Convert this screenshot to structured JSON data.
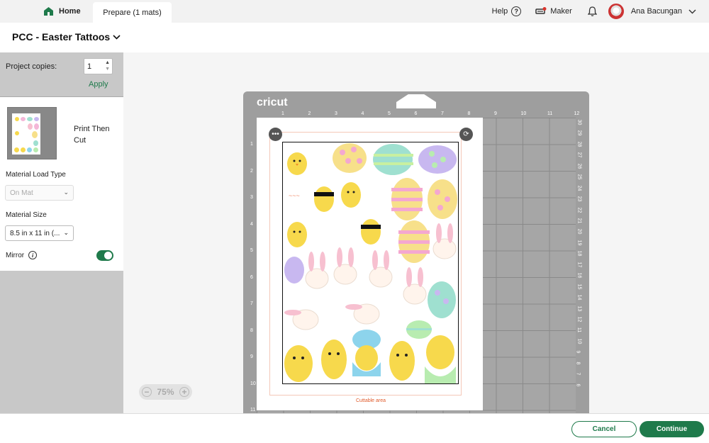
{
  "topbar": {
    "home_label": "Home",
    "prepare_tab_label": "Prepare (1 mats)",
    "help_label": "Help",
    "machine_label": "Maker",
    "user_name": "Ana Bacungan"
  },
  "project": {
    "title": "PCC - Easter Tattoos"
  },
  "left_panel": {
    "copies_label": "Project copies:",
    "copies_value": "1",
    "apply_label": "Apply",
    "mat_mode_label": "Print Then Cut",
    "material_load_label": "Material Load Type",
    "material_load_value": "On Mat",
    "material_size_label": "Material Size",
    "material_size_value": "8.5 in x 11 in (...",
    "mirror_label": "Mirror",
    "mirror_on": true
  },
  "mat": {
    "brand": "cricut",
    "cut_area_label": "Cuttable area",
    "top_ruler": [
      "1",
      "2",
      "3",
      "4",
      "5",
      "6",
      "7",
      "8",
      "9",
      "10",
      "11",
      "12"
    ],
    "left_ruler": [
      "1",
      "2",
      "3",
      "4",
      "5",
      "6",
      "7",
      "8",
      "9",
      "10",
      "11"
    ],
    "right_ruler": [
      "30",
      "29",
      "28",
      "27",
      "26",
      "25",
      "24",
      "23",
      "22",
      "21",
      "20",
      "19",
      "18",
      "17",
      "16",
      "15",
      "14",
      "13",
      "12",
      "11",
      "10",
      "9",
      "8",
      "7",
      "6"
    ]
  },
  "zoom": {
    "level": "75%"
  },
  "footer": {
    "cancel_label": "Cancel",
    "continue_label": "Continue"
  },
  "colors": {
    "accent": "#1f7a4b",
    "cut_line": "#e05a2a"
  }
}
